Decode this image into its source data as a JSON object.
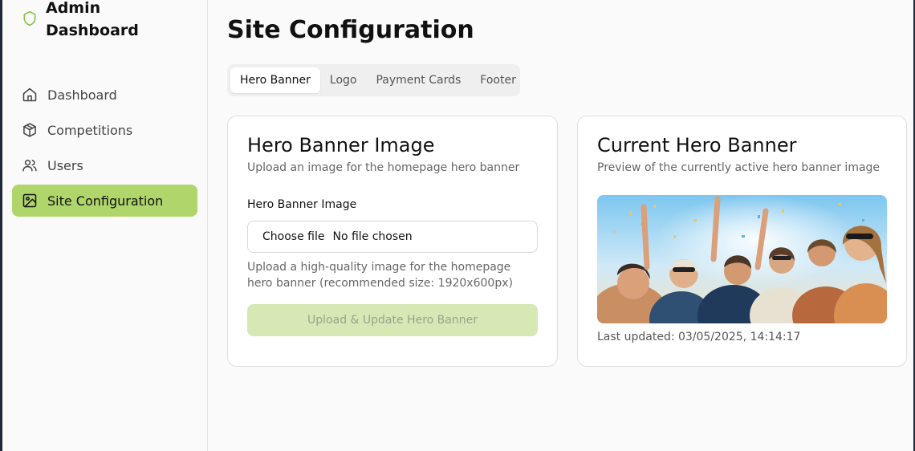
{
  "brand": {
    "title_line1": "Admin",
    "title_line2": "Dashboard",
    "icon": "shield-icon"
  },
  "sidebar": {
    "items": [
      {
        "label": "Dashboard",
        "icon": "home-icon",
        "active": false
      },
      {
        "label": "Competitions",
        "icon": "box-icon",
        "active": false
      },
      {
        "label": "Users",
        "icon": "users-icon",
        "active": false
      },
      {
        "label": "Site Configuration",
        "icon": "image-icon",
        "active": true
      }
    ]
  },
  "main": {
    "title": "Site Configuration",
    "tabs": [
      {
        "label": "Hero Banner",
        "active": true
      },
      {
        "label": "Logo",
        "active": false
      },
      {
        "label": "Payment Cards",
        "active": false
      },
      {
        "label": "Footer",
        "active": false
      }
    ],
    "upload_card": {
      "title": "Hero Banner Image",
      "subtitle": "Upload an image for the homepage hero banner",
      "field_label": "Hero Banner Image",
      "file_button": "Choose file",
      "file_status": "No file chosen",
      "help_text": "Upload a high-quality image for the homepage hero banner (recommended size: 1920x600px)",
      "submit_label": "Upload & Update Hero Banner"
    },
    "preview_card": {
      "title": "Current Hero Banner",
      "subtitle": "Preview of the currently active hero banner image",
      "last_updated": "Last updated: 03/05/2025, 14:14:17"
    }
  },
  "colors": {
    "accent": "#b0d56a",
    "accent_disabled": "#d6e8b4",
    "brand_icon": "#8bc34a"
  }
}
